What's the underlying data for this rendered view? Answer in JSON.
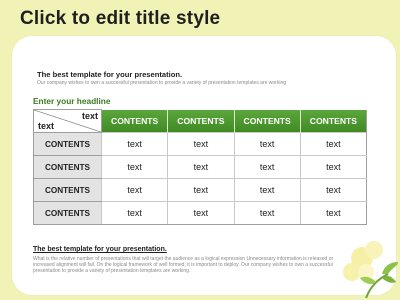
{
  "slide": {
    "title": "Click to edit title style",
    "subheading": "The best template for your presentation.",
    "subtext": "Our company wishes to own a successful presentation to provide a variety of presentation templates are working",
    "headline": "Enter your headline"
  },
  "table": {
    "corner_top": "text",
    "corner_bottom": "text",
    "columns": [
      "CONTENTS",
      "CONTENTS",
      "CONTENTS",
      "CONTENTS"
    ],
    "rows": [
      {
        "label": "CONTENTS",
        "cells": [
          "text",
          "text",
          "text",
          "text"
        ]
      },
      {
        "label": "CONTENTS",
        "cells": [
          "text",
          "text",
          "text",
          "text"
        ]
      },
      {
        "label": "CONTENTS",
        "cells": [
          "text",
          "text",
          "text",
          "text"
        ]
      },
      {
        "label": "CONTENTS",
        "cells": [
          "text",
          "text",
          "text",
          "text"
        ]
      }
    ],
    "header_color": "#4a9a2e"
  },
  "footer": {
    "heading": "The best template for your presentation.",
    "line1": "What is the relative number of presentations that will target the audience as a logical expression Unnecessary information is released or",
    "line2": "increased alignment will fail. On the logical framework of well formed, it is important to deploy. Our company wishes to own a successful",
    "line3": "presentation to provide a variety of presentation templates are working."
  },
  "theme": {
    "background": "#f1f3b6",
    "accent_green": "#3b7a1e"
  }
}
